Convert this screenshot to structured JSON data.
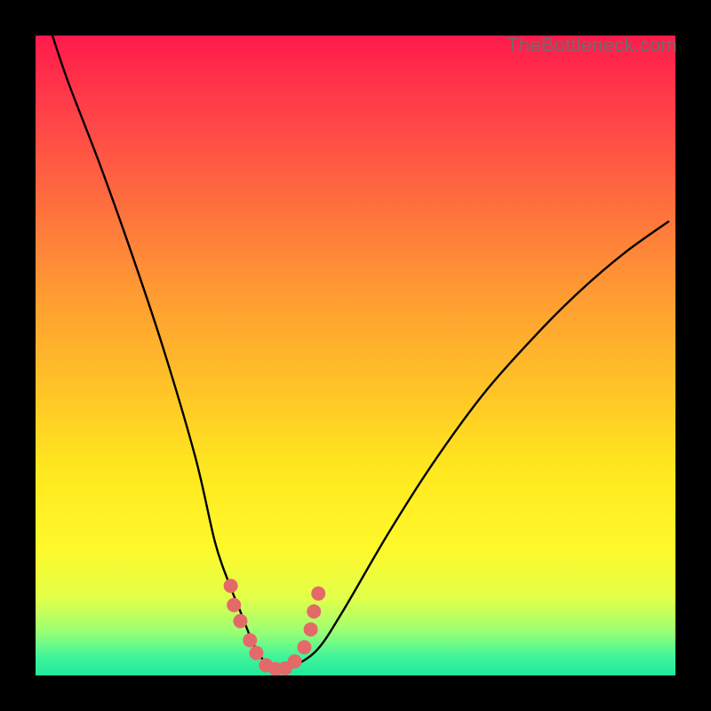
{
  "watermark": "TheBottleneck.com",
  "colors": {
    "background": "#000000",
    "gradient_top": "#ff1a4b",
    "gradient_bottom": "#20e89c",
    "curve_stroke": "#000000",
    "marker_fill": "#e46a6a"
  },
  "chart_data": {
    "type": "line",
    "title": "",
    "xlabel": "",
    "ylabel": "",
    "xlim": [
      0,
      100
    ],
    "ylim": [
      0,
      100
    ],
    "grid": false,
    "legend": false,
    "series": [
      {
        "name": "bottleneck-curve",
        "x": [
          2,
          5,
          10,
          15,
          20,
          25,
          28,
          30,
          32,
          34,
          35.5,
          37,
          38,
          39,
          40,
          44,
          48,
          55,
          62,
          70,
          78,
          85,
          92,
          99
        ],
        "values": [
          102,
          93,
          80,
          66,
          51,
          34,
          21,
          15,
          10,
          5,
          2.5,
          1,
          0.5,
          0.6,
          1.2,
          4,
          10,
          22,
          33,
          44,
          53,
          60,
          66,
          71
        ]
      }
    ],
    "markers": [
      {
        "x": 30.5,
        "y": 14
      },
      {
        "x": 31.0,
        "y": 11
      },
      {
        "x": 32.0,
        "y": 8.5
      },
      {
        "x": 33.5,
        "y": 5.5
      },
      {
        "x": 34.5,
        "y": 3.5
      },
      {
        "x": 36.0,
        "y": 1.6
      },
      {
        "x": 37.5,
        "y": 1.0
      },
      {
        "x": 39.0,
        "y": 1.1
      },
      {
        "x": 40.5,
        "y": 2.2
      },
      {
        "x": 42.0,
        "y": 4.4
      },
      {
        "x": 43.0,
        "y": 7.2
      },
      {
        "x": 43.5,
        "y": 10.0
      },
      {
        "x": 44.2,
        "y": 12.8
      }
    ]
  }
}
